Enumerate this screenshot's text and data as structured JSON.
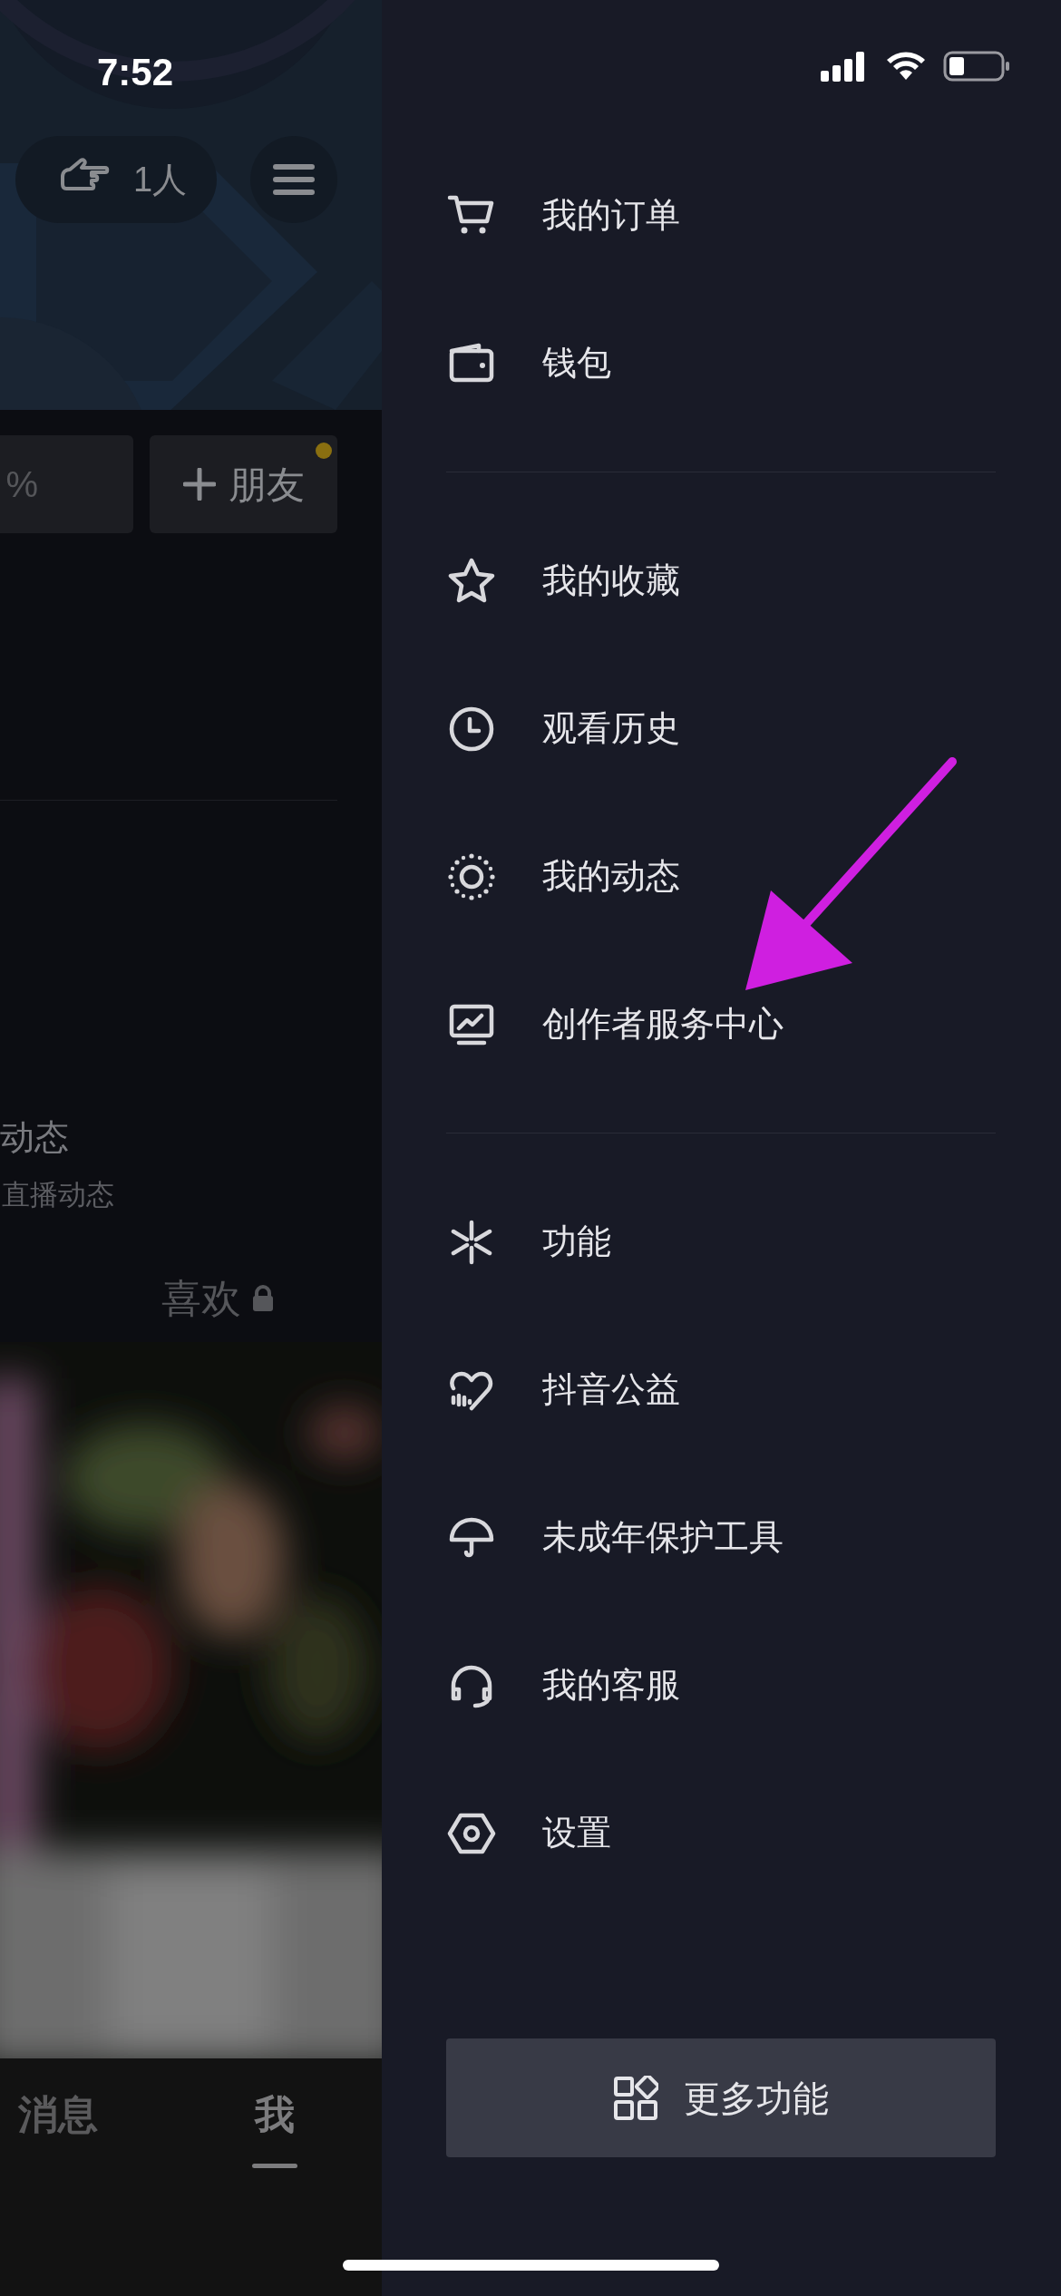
{
  "status_bar": {
    "time": "7:52"
  },
  "profile": {
    "viewers": "1人",
    "stat_fragment": "%",
    "friend_button": {
      "label": "朋友",
      "badge": true
    },
    "posts_title": "动态",
    "posts_subtitle": "直播动态",
    "likes_tab": {
      "label": "喜欢",
      "locked": true
    }
  },
  "bottom_tabs": [
    {
      "label": "消息",
      "selected": false
    },
    {
      "label": "我",
      "selected": true
    }
  ],
  "drawer": {
    "groups": [
      [
        {
          "label": "我的订单"
        },
        {
          "label": "钱包"
        }
      ],
      [
        {
          "label": "我的收藏"
        },
        {
          "label": "观看历史"
        },
        {
          "label": "我的动态"
        },
        {
          "label": "创作者服务中心"
        }
      ],
      [
        {
          "label": "功能"
        },
        {
          "label": "抖音公益"
        },
        {
          "label": "未成年保护工具"
        },
        {
          "label": "我的客服"
        },
        {
          "label": "设置"
        }
      ]
    ],
    "more_button": "更多功能"
  }
}
